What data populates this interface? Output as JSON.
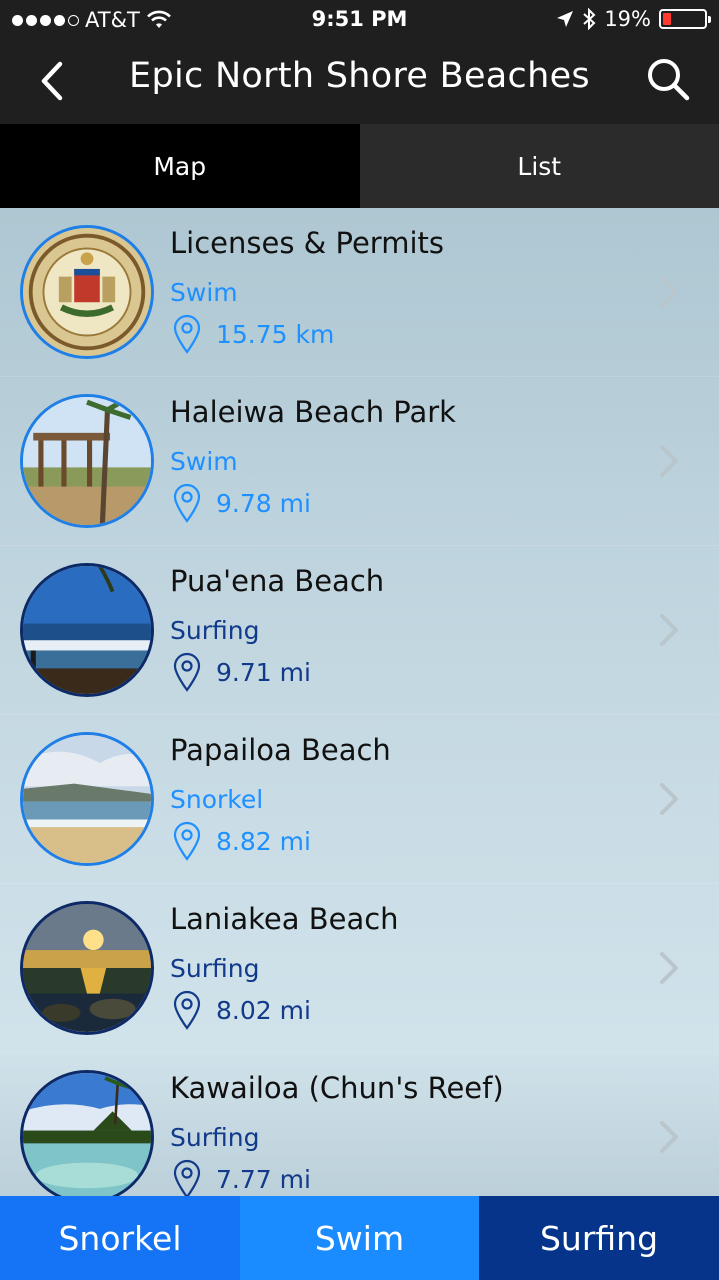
{
  "status_bar": {
    "carrier": "AT&T",
    "time": "9:51 PM",
    "battery_percent": "19%",
    "battery_level": 0.19
  },
  "nav": {
    "title": "Epic North Shore Beaches",
    "back_icon": "chevron-left-icon",
    "search_icon": "search-icon"
  },
  "segments": [
    {
      "label": "Map",
      "active": true
    },
    {
      "label": "List",
      "active": false
    }
  ],
  "beaches": [
    {
      "name": "Licenses & Permits",
      "category": "Swim",
      "distance": "15.75 km"
    },
    {
      "name": "Haleiwa Beach Park",
      "category": "Swim",
      "distance": "9.78 mi"
    },
    {
      "name": "Pua'ena Beach",
      "category": "Surfing",
      "distance": "9.71 mi"
    },
    {
      "name": "Papailoa Beach",
      "category": "Snorkel",
      "distance": "8.82 mi"
    },
    {
      "name": "Laniakea Beach",
      "category": "Surfing",
      "distance": "8.02 mi"
    },
    {
      "name": "Kawailoa (Chun's Reef)",
      "category": "Surfing",
      "distance": "7.77 mi"
    }
  ],
  "category_colors": {
    "Swim": "#1e90ff",
    "Snorkel": "#1e90ff",
    "Surfing": "#123a8a"
  },
  "bottom_tabs": [
    {
      "label": "Snorkel",
      "color": "#1573f5"
    },
    {
      "label": "Swim",
      "color": "#1a8cff"
    },
    {
      "label": "Surfing",
      "color": "#06348a"
    }
  ]
}
